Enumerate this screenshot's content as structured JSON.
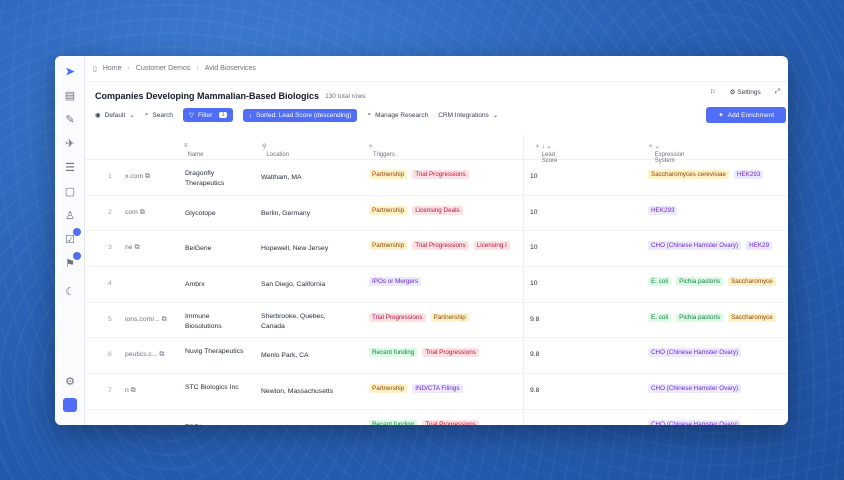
{
  "breadcrumb": [
    "Home",
    "Customer Demos",
    "Avid Bioservices"
  ],
  "title": "Companies Developing Mammalian-Based Biologics",
  "row_count": "130 total rows",
  "header_actions": {
    "settings": "Settings"
  },
  "toolbar": {
    "view": "Default",
    "search": "Search",
    "filter": "Filter",
    "filter_count": "1",
    "sort": "Sorted: Lead Score (descending)",
    "manage": "Manage Research",
    "crm": "CRM Integrations",
    "add": "Add Enrichment"
  },
  "columns": [
    "Name",
    "Location",
    "Triggers",
    "Lead Score",
    "Expression System"
  ],
  "rows": [
    {
      "n": "1",
      "url": "x.com",
      "name": "Dragonfly Therapeutics",
      "loc": "Waltham, MA",
      "triggers": [
        [
          "Partnership",
          "yellow"
        ],
        [
          "Trial Progressions",
          "red"
        ]
      ],
      "score": "10",
      "expr": [
        [
          "Saccharomyces cerevisiae",
          "yellow"
        ],
        [
          "HEK293",
          "purple"
        ]
      ]
    },
    {
      "n": "2",
      "url": "com",
      "name": "Glycotope",
      "loc": "Berlin, Germany",
      "triggers": [
        [
          "Partnership",
          "yellow"
        ],
        [
          "Licensing Deals",
          "red"
        ]
      ],
      "score": "10",
      "expr": [
        [
          "HEK293",
          "purple"
        ]
      ]
    },
    {
      "n": "3",
      "url": "ne",
      "name": "BeiGene",
      "loc": "Hopewell, New Jersey",
      "triggers": [
        [
          "Partnership",
          "yellow"
        ],
        [
          "Trial Progressions",
          "red"
        ],
        [
          "Licensing I",
          "red"
        ]
      ],
      "score": "10",
      "expr": [
        [
          "CHO (Chinese Hamster Ovary)",
          "purple"
        ],
        [
          "HEK29",
          "purple"
        ]
      ]
    },
    {
      "n": "4",
      "url": "",
      "name": "Ambrx",
      "loc": "San Diego, California",
      "triggers": [
        [
          "IPOs or Mergers",
          "purple"
        ]
      ],
      "score": "10",
      "expr": [
        [
          "E. coli",
          "green"
        ],
        [
          "Pichia pastoris",
          "green"
        ],
        [
          "Saccharomyce",
          "yellow"
        ]
      ]
    },
    {
      "n": "5",
      "url": "ions.com/...",
      "name": "Immune Biosolutions",
      "loc": "Sherbrooke, Quebec, Canada",
      "triggers": [
        [
          "Trial Progressions",
          "red"
        ],
        [
          "Partnership",
          "yellow"
        ]
      ],
      "score": "9.8",
      "expr": [
        [
          "E. coli",
          "green"
        ],
        [
          "Pichia pastoris",
          "green"
        ],
        [
          "Saccharomyce",
          "yellow"
        ]
      ]
    },
    {
      "n": "6",
      "url": "peutics.c...",
      "name": "Nuvig Therapeutics",
      "loc": "Menlo Park, CA",
      "triggers": [
        [
          "Recent funding",
          "green"
        ],
        [
          "Trial Progressions",
          "red"
        ]
      ],
      "score": "9.8",
      "expr": [
        [
          "CHO (Chinese Hamster Ovary)",
          "purple"
        ]
      ]
    },
    {
      "n": "7",
      "url": "n",
      "name": "STC Biologics Inc",
      "loc": "Newton, Massachusetts",
      "triggers": [
        [
          "Partnership",
          "yellow"
        ],
        [
          "IND/CTA Filings",
          "purple"
        ]
      ],
      "score": "9.8",
      "expr": [
        [
          "CHO (Chinese Hamster Ovary)",
          "purple"
        ]
      ]
    },
    {
      "n": "",
      "url": "",
      "name": "TORL",
      "loc": "",
      "triggers": [
        [
          "Recent funding",
          "green"
        ],
        [
          "Trial Progressions",
          "red"
        ]
      ],
      "score": "",
      "expr": [
        [
          "CHO (Chinese Hamster Ovary)",
          "purple"
        ]
      ]
    }
  ]
}
